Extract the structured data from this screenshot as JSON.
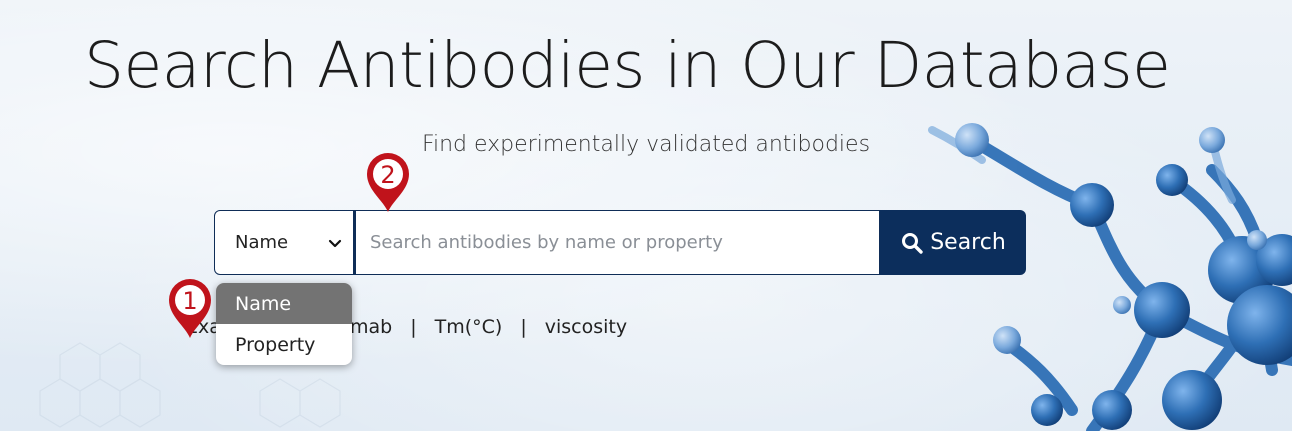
{
  "page": {
    "title": "Search Antibodies in Our Database",
    "subtitle": "Find experimentally validated antibodies"
  },
  "search": {
    "select_value": "Name",
    "placeholder": "Search antibodies by name or property",
    "button_label": "Search",
    "options": [
      "Name",
      "Property"
    ]
  },
  "examples": {
    "prefix": "Exa",
    "items": [
      "uzumab",
      "Tm(°C)",
      "viscosity"
    ],
    "separator": "|"
  },
  "markers": {
    "one": "1",
    "two": "2",
    "color": "#c0131b"
  },
  "colors": {
    "brand_navy": "#0c2e5c",
    "selected_option": "#737373",
    "molecule_blue": "#2e6fb5"
  }
}
